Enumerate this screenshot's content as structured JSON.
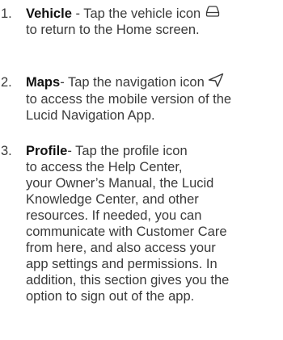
{
  "items": [
    {
      "number": "1.",
      "term": "Vehicle",
      "sep": " - ",
      "text_before_icon": "Tap the vehicle icon ",
      "icon": "vehicle-icon",
      "line2": "to return to the Home screen."
    },
    {
      "number": "2.",
      "term": "Maps",
      "sep": "- ",
      "text_before_icon": "Tap the navigation icon ",
      "icon": "navigation-icon",
      "line2": "to access the mobile version of the",
      "line3": "Lucid Navigation App."
    },
    {
      "number": "3.",
      "term": "Profile",
      "sep": "- ",
      "lines": [
        "Tap the profile icon",
        "to access the Help Center,",
        "your Owner’s Manual, the Lucid",
        "Knowledge Center, and other",
        "resources. If needed, you can",
        "communicate with Customer Care",
        "from here, and also access your",
        "app settings and permissions. In",
        "addition, this section gives you the",
        "option to sign out of the app."
      ]
    }
  ]
}
